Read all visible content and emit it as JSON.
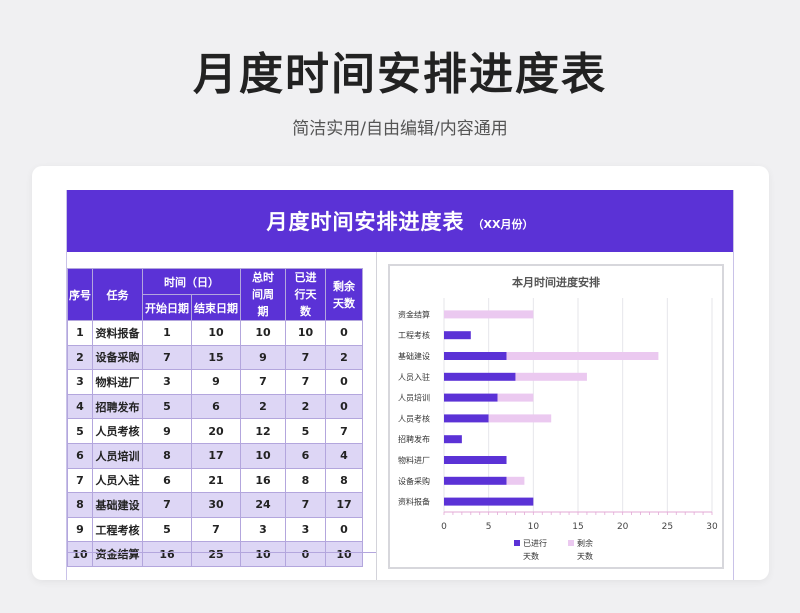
{
  "page": {
    "title": "月度时间安排进度表",
    "subtitle": "简洁实用/自由编辑/内容通用"
  },
  "sheet": {
    "title": "月度时间安排进度表",
    "subtitle": "（XX月份）"
  },
  "table": {
    "headers": {
      "index": "序号",
      "task": "任务",
      "time_group": "时间（日）",
      "start": "开始日期",
      "end": "结束日期",
      "period": "总时间周期",
      "done": "已进行天数",
      "remaining": "剩余天数"
    },
    "rows": [
      {
        "index": "1",
        "task": "资料报备",
        "start": "1",
        "end": "10",
        "period": "10",
        "done": "10",
        "remaining": "0"
      },
      {
        "index": "2",
        "task": "设备采购",
        "start": "7",
        "end": "15",
        "period": "9",
        "done": "7",
        "remaining": "2"
      },
      {
        "index": "3",
        "task": "物料进厂",
        "start": "3",
        "end": "9",
        "period": "7",
        "done": "7",
        "remaining": "0"
      },
      {
        "index": "4",
        "task": "招聘发布",
        "start": "5",
        "end": "6",
        "period": "2",
        "done": "2",
        "remaining": "0"
      },
      {
        "index": "5",
        "task": "人员考核",
        "start": "9",
        "end": "20",
        "period": "12",
        "done": "5",
        "remaining": "7"
      },
      {
        "index": "6",
        "task": "人员培训",
        "start": "8",
        "end": "17",
        "period": "10",
        "done": "6",
        "remaining": "4"
      },
      {
        "index": "7",
        "task": "人员入驻",
        "start": "6",
        "end": "21",
        "period": "16",
        "done": "8",
        "remaining": "8"
      },
      {
        "index": "8",
        "task": "基础建设",
        "start": "7",
        "end": "30",
        "period": "24",
        "done": "7",
        "remaining": "17"
      },
      {
        "index": "9",
        "task": "工程考核",
        "start": "5",
        "end": "7",
        "period": "3",
        "done": "3",
        "remaining": "0"
      },
      {
        "index": "10",
        "task": "资金结算",
        "start": "16",
        "end": "25",
        "period": "10",
        "done": "0",
        "remaining": "10"
      }
    ]
  },
  "colors": {
    "accent": "#5b32d6",
    "row_alt": "#ddd6f5",
    "remaining_bar": "#ebc9f0"
  },
  "chart_data": {
    "type": "bar",
    "orientation": "horizontal",
    "stacked": true,
    "title": "本月时间进度安排",
    "categories": [
      "资料报备",
      "设备采购",
      "物料进厂",
      "招聘发布",
      "人员考核",
      "人员培训",
      "人员入驻",
      "基础建设",
      "工程考核",
      "资金结算"
    ],
    "series": [
      {
        "name": "已进行天数",
        "color": "#5b32d6",
        "values": [
          10,
          7,
          7,
          2,
          5,
          6,
          8,
          7,
          3,
          0
        ]
      },
      {
        "name": "剩余天数",
        "color": "#ebc9f0",
        "values": [
          0,
          2,
          0,
          0,
          7,
          4,
          8,
          17,
          0,
          10
        ]
      }
    ],
    "xlim": [
      0,
      30
    ],
    "xticks": [
      "0",
      "5",
      "10",
      "15",
      "20",
      "25",
      "30"
    ],
    "grid": true,
    "legend": "bottom",
    "legend_entries": [
      {
        "line1": "已进行",
        "line2": "天数"
      },
      {
        "line1": "剩余",
        "line2": "天数"
      }
    ]
  }
}
